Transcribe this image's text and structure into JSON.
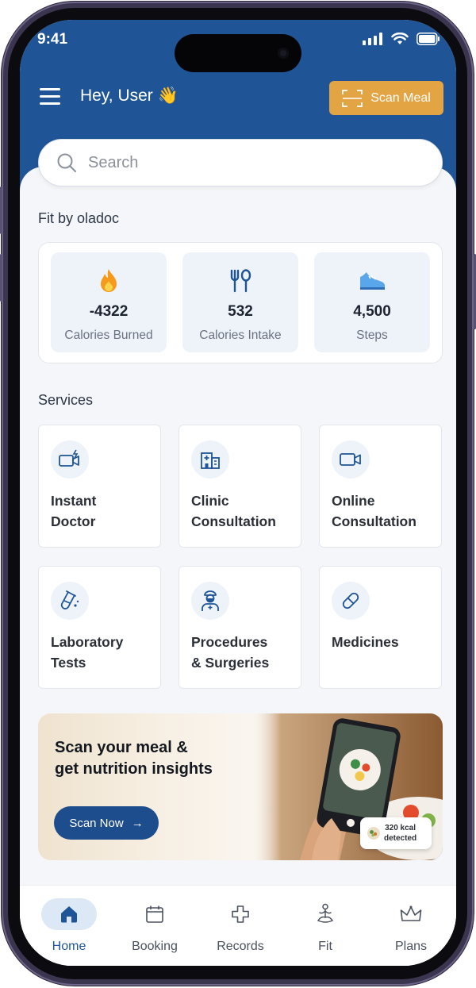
{
  "status_bar": {
    "time": "9:41"
  },
  "header": {
    "greeting": "Hey, User",
    "greeting_emoji": "👋",
    "scan_meal_label": "Scan Meal"
  },
  "search": {
    "placeholder": "Search"
  },
  "fit_section": {
    "title": "Fit by oladoc",
    "stats": [
      {
        "icon": "flame-icon",
        "value": "-4322",
        "label": "Calories Burned"
      },
      {
        "icon": "fork-spoon-icon",
        "value": "532",
        "label": "Calories Intake"
      },
      {
        "icon": "sneaker-icon",
        "value": "4,500",
        "label": "Steps"
      }
    ]
  },
  "services_section": {
    "title": "Services",
    "items": [
      {
        "icon": "video-call-instant-icon",
        "line1": "Instant",
        "line2": "Doctor"
      },
      {
        "icon": "hospital-icon",
        "line1": "Clinic",
        "line2": "Consultation"
      },
      {
        "icon": "video-camera-icon",
        "line1": "Online",
        "line2": "Consultation"
      },
      {
        "icon": "test-tube-icon",
        "line1": "Laboratory",
        "line2": "Tests"
      },
      {
        "icon": "surgeon-icon",
        "line1": "Procedures",
        "line2": "& Surgeries"
      },
      {
        "icon": "pill-icon",
        "line1": "Medicines",
        "line2": ""
      }
    ]
  },
  "banner": {
    "title_line1": "Scan your meal &",
    "title_line2": "get nutrition insights",
    "button_label": "Scan Now",
    "button_arrow": "→",
    "badge_line1": "320 kcal",
    "badge_line2": "detected"
  },
  "bottom_nav": {
    "items": [
      {
        "label": "Home",
        "icon": "home-icon",
        "active": true
      },
      {
        "label": "Booking",
        "icon": "calendar-icon",
        "active": false
      },
      {
        "label": "Records",
        "icon": "medical-cross-icon",
        "active": false
      },
      {
        "label": "Fit",
        "icon": "meditation-icon",
        "active": false
      },
      {
        "label": "Plans",
        "icon": "crown-icon",
        "active": false
      }
    ]
  },
  "colors": {
    "header_bg": "#1f5596",
    "accent_orange": "#e3a443",
    "primary_blue": "#1d4d8c",
    "background": "#f4f6f9"
  }
}
